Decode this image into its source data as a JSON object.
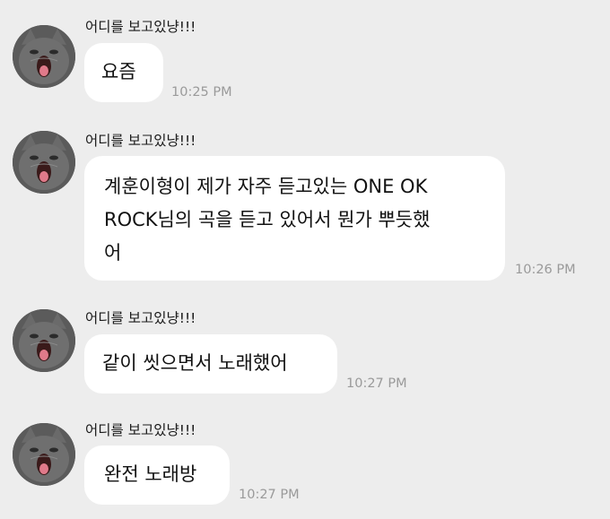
{
  "sender_name": "어디를 보고있냥!!!",
  "messages": [
    {
      "lines": [
        "요즘"
      ],
      "time": "10:25 PM"
    },
    {
      "lines": [
        "계훈이형이 제가 자주 듣고있는 ONE OK",
        "ROCK님의 곡을 듣고 있어서 뭔가 뿌듯했",
        "어"
      ],
      "time": "10:26 PM"
    },
    {
      "lines": [
        "같이 씻으면서 노래했어"
      ],
      "time": "10:27 PM"
    },
    {
      "lines": [
        "완전 노래방"
      ],
      "time": "10:27 PM"
    }
  ],
  "colors": {
    "background": "#ededed",
    "bubble": "#ffffff",
    "timestamp": "#9a9a9a"
  },
  "icons": {
    "avatar": "screaming-cat-avatar-icon"
  }
}
